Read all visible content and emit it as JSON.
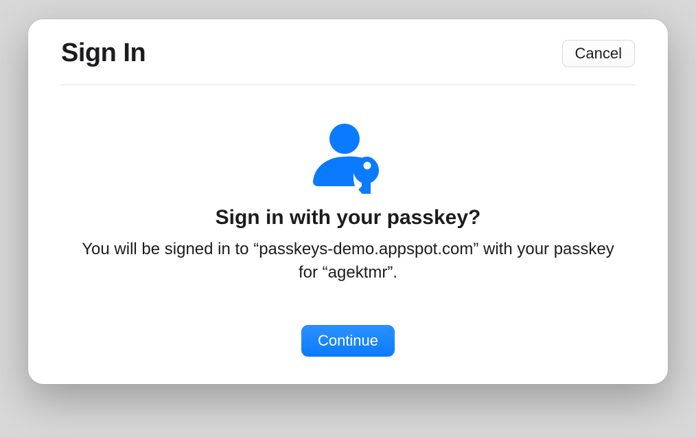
{
  "header": {
    "title": "Sign In",
    "cancel_label": "Cancel"
  },
  "prompt": {
    "icon": "passkey-user-icon",
    "accent_color": "#0a7bff",
    "title": "Sign in with your passkey?",
    "description": "You will be signed in to “passkeys-demo.appspot.com” with your passkey for “agektmr”."
  },
  "footer": {
    "continue_label": "Continue"
  }
}
